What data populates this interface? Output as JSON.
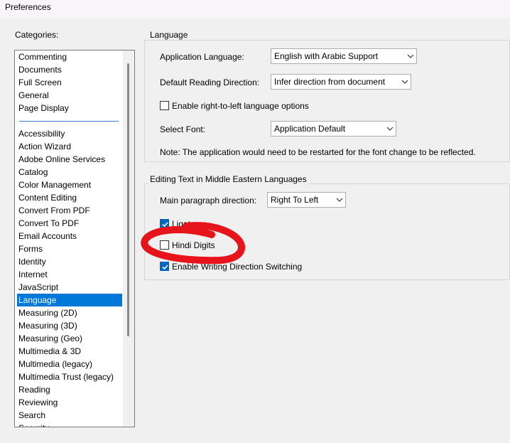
{
  "window": {
    "title": "Preferences"
  },
  "categories": {
    "label": "Categories:",
    "top_items": [
      "Commenting",
      "Documents",
      "Full Screen",
      "General",
      "Page Display"
    ],
    "items": [
      "Accessibility",
      "Action Wizard",
      "Adobe Online Services",
      "Catalog",
      "Color Management",
      "Content Editing",
      "Convert From PDF",
      "Convert To PDF",
      "Email Accounts",
      "Forms",
      "Identity",
      "Internet",
      "JavaScript",
      "Language",
      "Measuring (2D)",
      "Measuring (3D)",
      "Measuring (Geo)",
      "Multimedia & 3D",
      "Multimedia (legacy)",
      "Multimedia Trust (legacy)",
      "Reading",
      "Reviewing",
      "Search",
      "Security"
    ],
    "selected": "Language"
  },
  "language": {
    "title": "Language",
    "app_language": {
      "label": "Application Language:",
      "value": "English with Arabic Support"
    },
    "reading_direction": {
      "label": "Default Reading Direction:",
      "value": "Infer direction from document"
    },
    "rtl_options": {
      "label": "Enable right-to-left language options",
      "checked": false
    },
    "select_font": {
      "label": "Select Font:",
      "value": "Application Default"
    },
    "note": "Note: The application would need to be restarted for the font change to be reflected."
  },
  "middle_east": {
    "title": "Editing Text in Middle Eastern Languages",
    "paragraph_direction": {
      "label": "Main paragraph direction:",
      "value": "Right To Left"
    },
    "ligatures": {
      "label": "Ligatures",
      "checked": true
    },
    "hindi_digits": {
      "label": "Hindi Digits",
      "checked": false
    },
    "writing_direction": {
      "label": "Enable Writing Direction Switching",
      "checked": true
    }
  },
  "colors": {
    "selection": "#0078d7",
    "checkbox_checked": "#0067c0",
    "annotation": "#e8141c"
  }
}
